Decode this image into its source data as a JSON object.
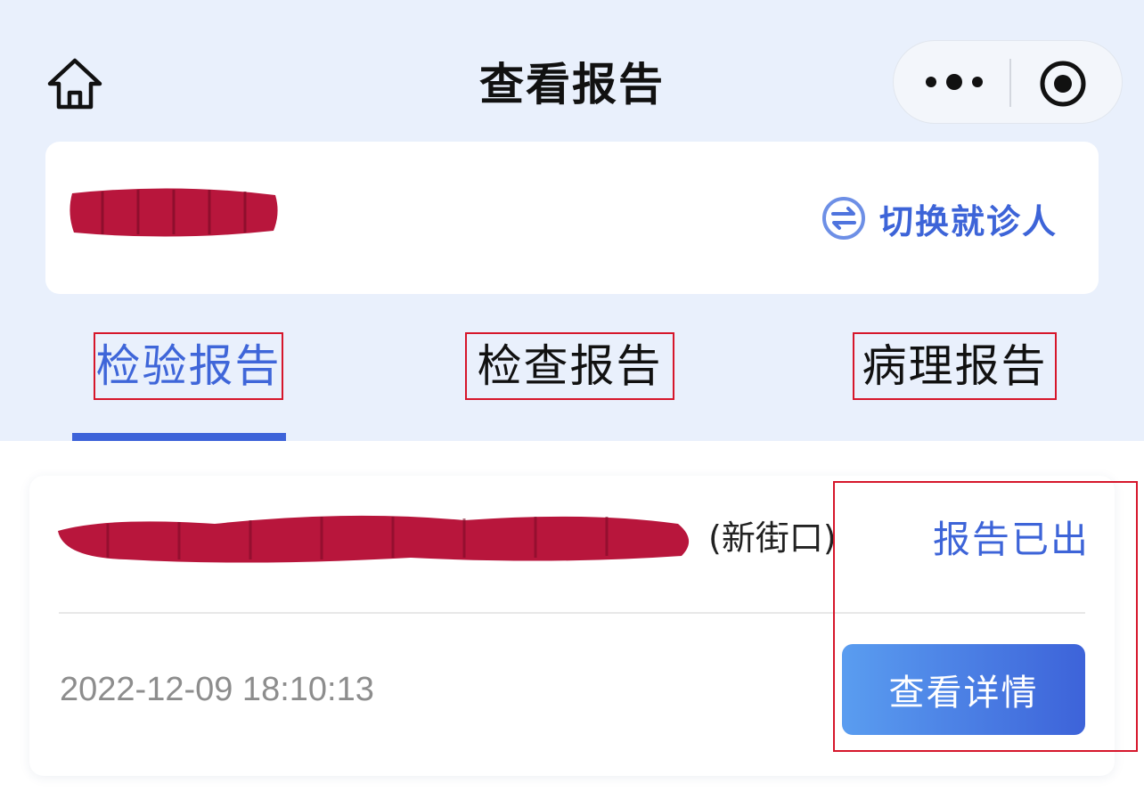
{
  "header": {
    "title": "查看报告"
  },
  "patient_card": {
    "switch_label": "切换就诊人"
  },
  "tabs": [
    {
      "label": "检验报告",
      "active": true
    },
    {
      "label": "检查报告",
      "active": false
    },
    {
      "label": "病理报告",
      "active": false
    }
  ],
  "reports": [
    {
      "hospital_suffix": "(新街口)",
      "status": "报告已出",
      "time": "2022-12-09 18:10:13",
      "detail_label": "查看详情"
    }
  ],
  "colors": {
    "accent": "#3d63d9",
    "header_bg": "#e9f0fc",
    "annotation": "#d6162b",
    "redaction": "#b8163c"
  },
  "icons": {
    "home": "home-icon",
    "more": "more-icon",
    "close": "target-icon",
    "switch": "switch-arrows-icon"
  }
}
